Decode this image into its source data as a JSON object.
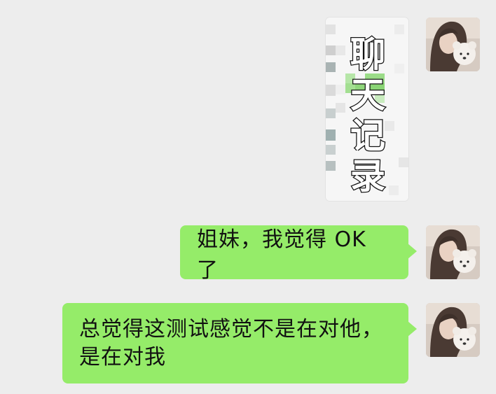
{
  "chat": {
    "messages": [
      {
        "type": "image",
        "sender": "self",
        "image_caption": "聊天记录"
      },
      {
        "type": "text",
        "sender": "self",
        "text": "姐妹，我觉得 OK 了"
      },
      {
        "type": "text",
        "sender": "self",
        "lines": [
          "总觉得这测试感觉不是在对他，",
          "是在对我"
        ]
      }
    ]
  },
  "colors": {
    "background": "#ededed",
    "bubble": "#95ec69",
    "text": "#111111"
  }
}
